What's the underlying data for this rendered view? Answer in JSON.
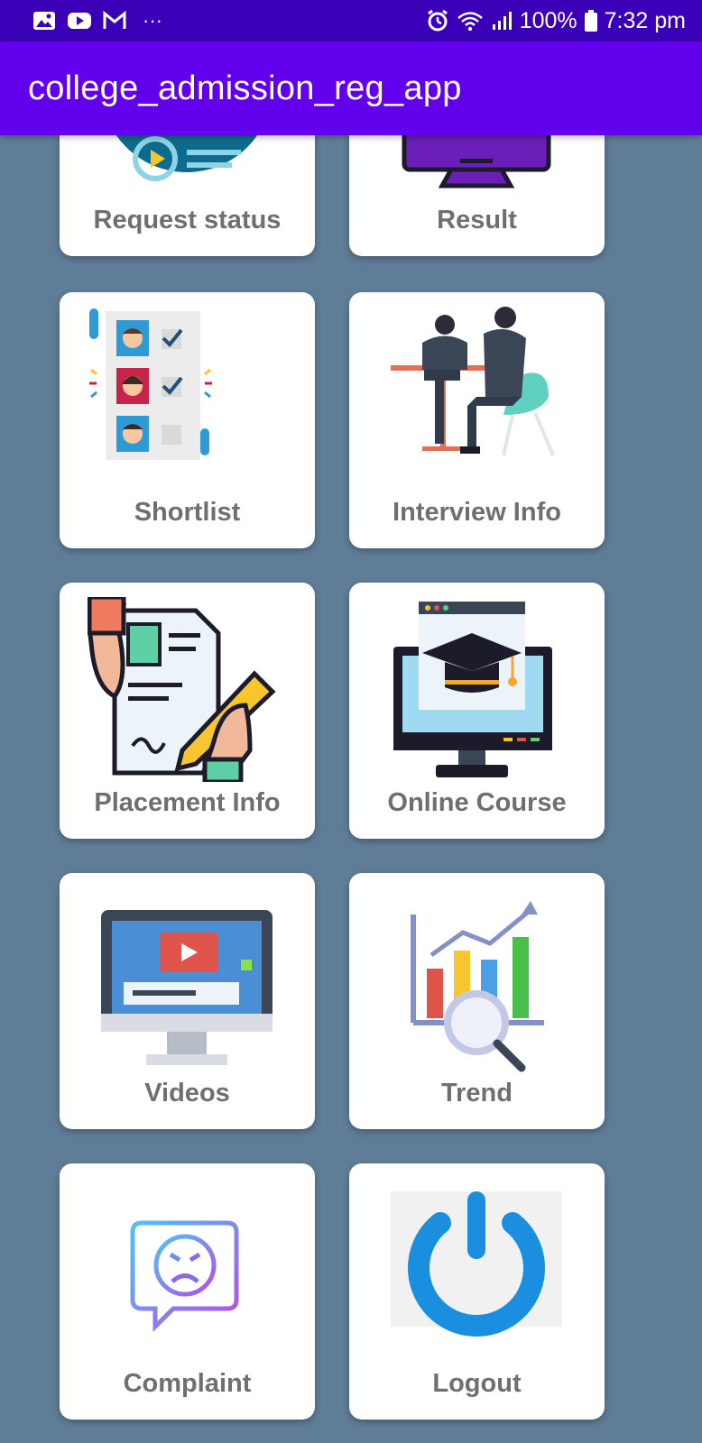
{
  "status_bar": {
    "battery": "100%",
    "time": "7:32 pm",
    "overflow": "···"
  },
  "app_bar": {
    "title": "college_admission_reg_app"
  },
  "colors": {
    "app_bar": "#6200ee",
    "status_bar": "#3a00b8",
    "background": "#607d98",
    "label": "#6f6f6f"
  },
  "menu": [
    {
      "label": "Request status",
      "icon": "request-status-icon"
    },
    {
      "label": "Result",
      "icon": "monitor-result-icon"
    },
    {
      "label": "Shortlist",
      "icon": "shortlist-icon"
    },
    {
      "label": "Interview Info",
      "icon": "interview-icon"
    },
    {
      "label": "Placement Info",
      "icon": "placement-document-icon"
    },
    {
      "label": "Online Course",
      "icon": "graduation-cap-monitor-icon"
    },
    {
      "label": "Videos",
      "icon": "video-monitor-icon"
    },
    {
      "label": "Trend",
      "icon": "trend-chart-icon"
    },
    {
      "label": "Complaint",
      "icon": "complaint-face-icon"
    },
    {
      "label": "Logout",
      "icon": "power-icon"
    }
  ]
}
